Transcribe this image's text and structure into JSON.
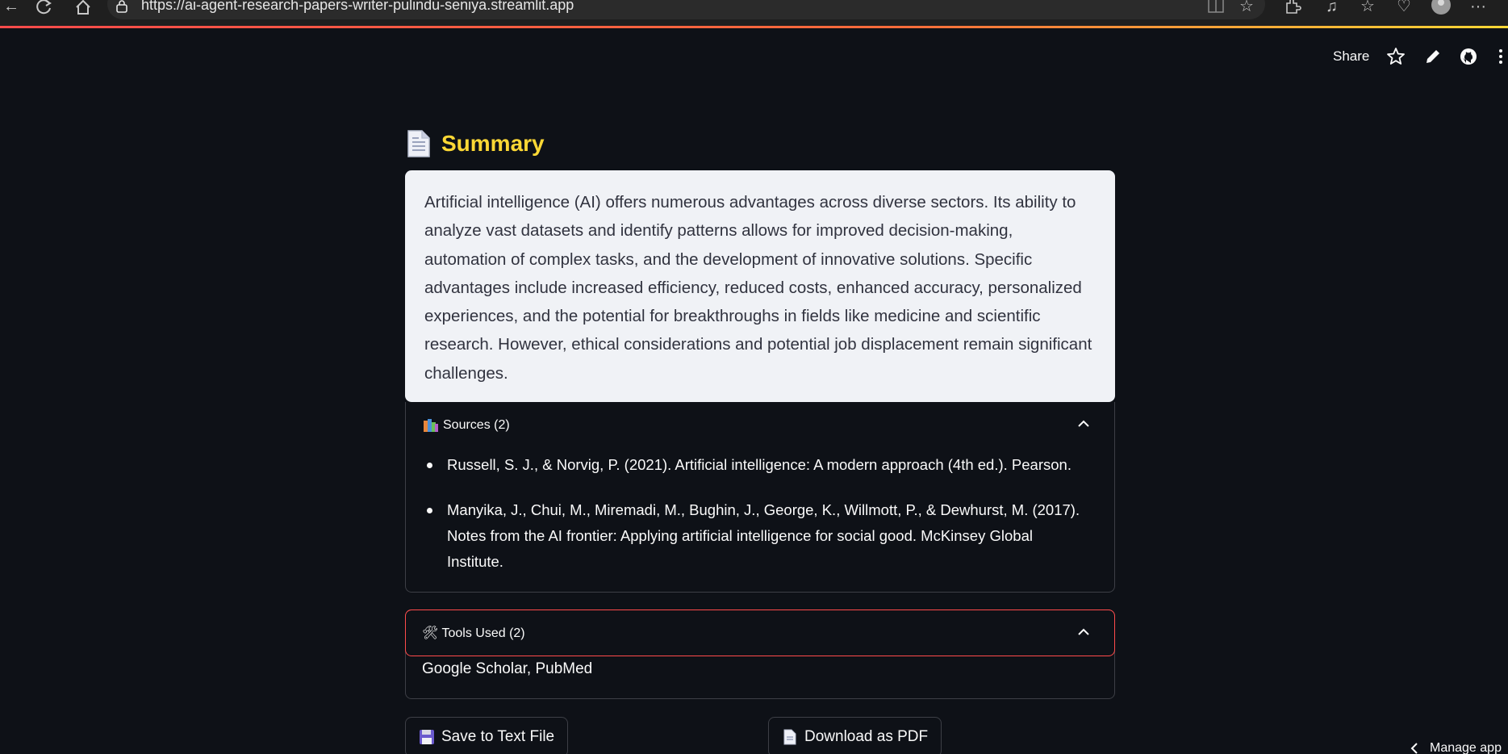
{
  "browser": {
    "url": "https://ai-agent-research-papers-writer-pulindu-seniya.streamlit.app"
  },
  "header": {
    "share_label": "Share"
  },
  "summary": {
    "title": "Summary",
    "text": "Artificial intelligence (AI) offers numerous advantages across diverse sectors.  Its ability to analyze vast datasets and identify patterns allows for improved decision-making, automation of complex tasks, and the development of innovative solutions.  Specific advantages include increased efficiency, reduced costs, enhanced accuracy, personalized experiences, and the potential for breakthroughs in fields like medicine and scientific research. However, ethical considerations and potential job displacement remain significant challenges."
  },
  "sources": {
    "label": "Sources (2)",
    "items": [
      "Russell, S. J., & Norvig, P. (2021). Artificial intelligence: A modern approach (4th ed.). Pearson.",
      "Manyika, J., Chui, M., Miremadi, M., Bughin, J., George, K., Willmott, P., & Dewhurst, M. (2017). Notes from the AI frontier: Applying artificial intelligence for social good. McKinsey Global Institute."
    ]
  },
  "tools": {
    "label": "🛠 Tools Used (2)",
    "value": "Google Scholar, PubMed"
  },
  "buttons": {
    "save_label": "Save to Text File",
    "pdf_label": "Download as PDF"
  },
  "footer": {
    "manage_label": "Manage app"
  },
  "colors": {
    "accent": "#fdd835",
    "primary": "#ff4b4b",
    "background": "#0e1117",
    "card": "#f0f2f6"
  }
}
